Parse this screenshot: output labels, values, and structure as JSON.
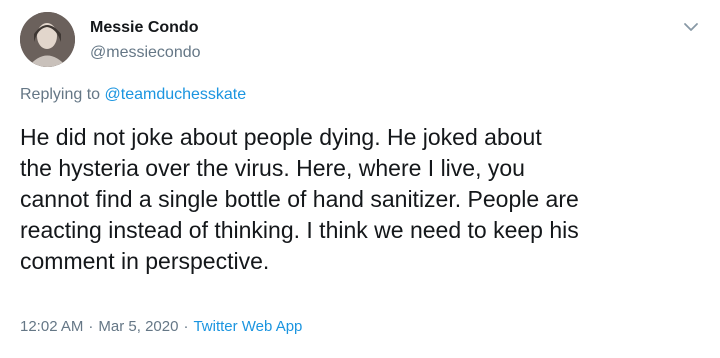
{
  "author": {
    "display_name": "Messie Condo",
    "handle": "@messiecondo",
    "avatar_icon": "avatar-icon"
  },
  "reply": {
    "prefix": "Replying to",
    "mention": "@teamduchesskate"
  },
  "tweet": {
    "text": "He did not joke about people dying. He joked about\nthe hysteria over the virus. Here, where I live, you\ncannot find a single bottle of hand sanitizer. People are\nreacting instead of thinking. I think we need to keep his\ncomment in perspective."
  },
  "meta": {
    "time": "12:02 AM",
    "separator": "·",
    "date": "Mar 5, 2020",
    "source": "Twitter Web App"
  },
  "colors": {
    "text": "#14171a",
    "secondary": "#657786",
    "link": "#1b95e0"
  },
  "icons": {
    "menu": "chevron-down-icon"
  }
}
